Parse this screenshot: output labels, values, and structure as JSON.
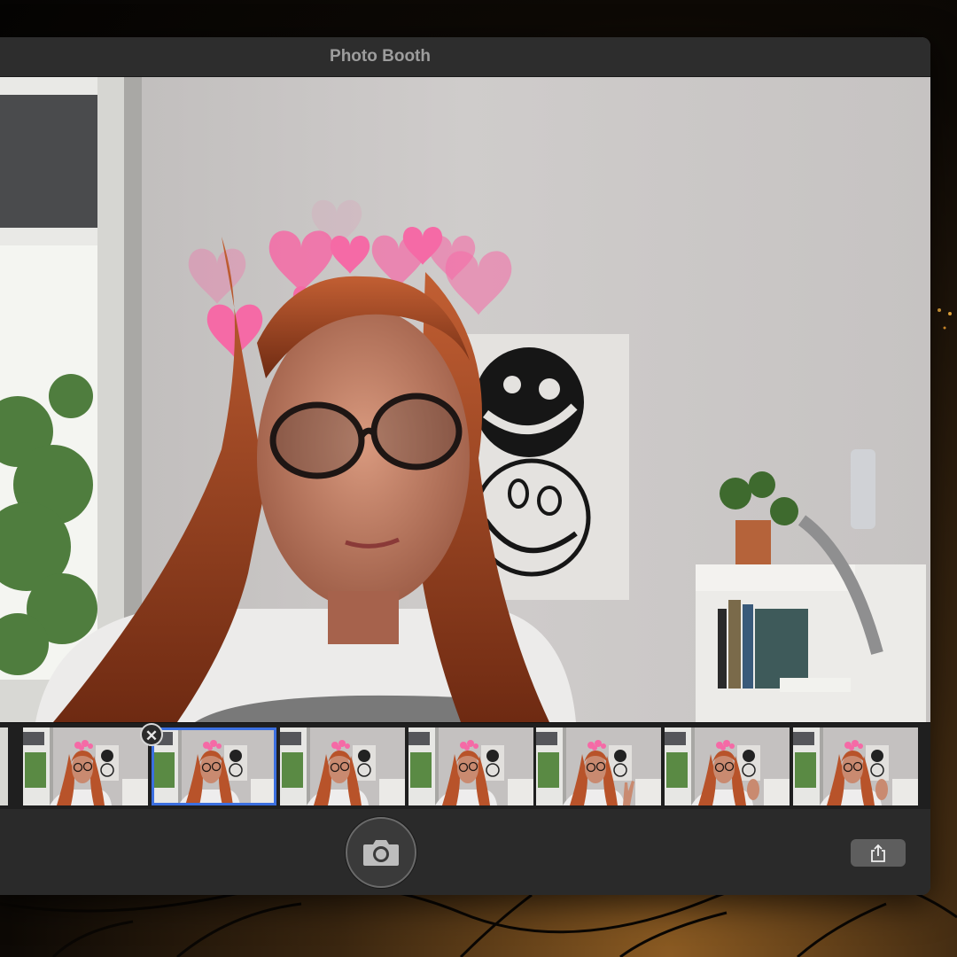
{
  "window": {
    "title": "Photo Booth"
  },
  "preview": {
    "effect": "hearts"
  },
  "filmstrip": {
    "selected_index": 1,
    "thumbnails": [
      {
        "pose": "neutral"
      },
      {
        "pose": "neutral"
      },
      {
        "pose": "neutral"
      },
      {
        "pose": "neutral"
      },
      {
        "pose": "peace-sign"
      },
      {
        "pose": "hand-raised"
      },
      {
        "pose": "hand-raised"
      }
    ]
  },
  "toolbar": {
    "shutter_icon": "camera-icon",
    "share_icon": "share-icon"
  },
  "colors": {
    "selection": "#3b6fe0",
    "heart": "#f56aa6",
    "hair": "#b8532a"
  }
}
